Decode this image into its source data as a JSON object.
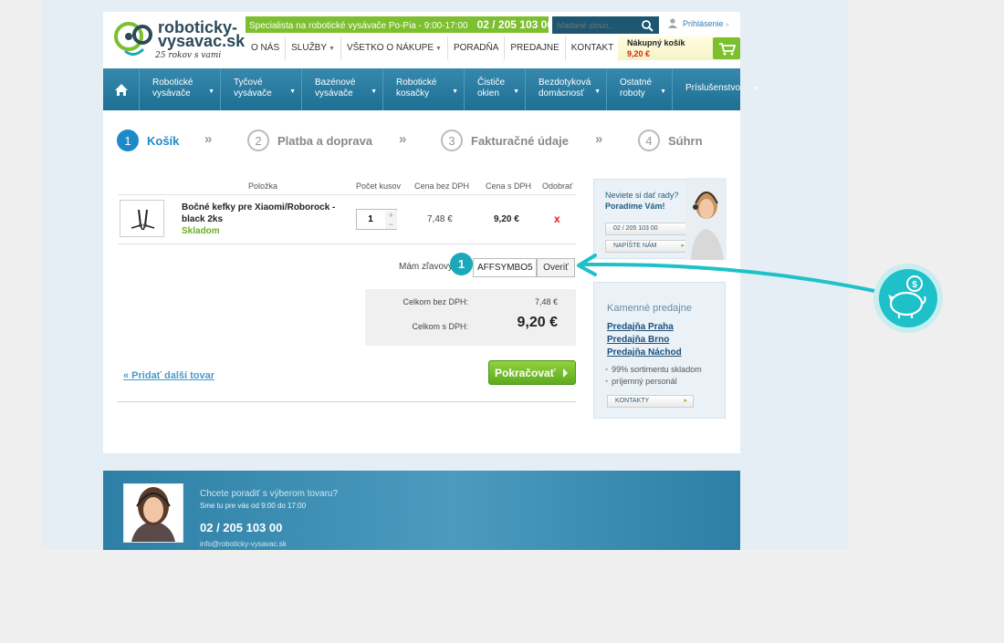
{
  "header": {
    "logo_line1": "roboticky-",
    "logo_line2": "vysavac.sk",
    "logo_slogan": "25 rokov s vami",
    "topbar_text": "Specialista na robotické vysávače   Po-Pia  -  9:00-17:00",
    "topbar_phone": "02 / 205 103 00",
    "search_placeholder": "hľadané slovo...",
    "login_label": "Prihlásenie",
    "nav": [
      {
        "label": "O NÁS",
        "dropdown": false
      },
      {
        "label": "SLUŽBY",
        "dropdown": true
      },
      {
        "label": "VŠETKO O NÁKUPE",
        "dropdown": true
      },
      {
        "label": "PORADŇA",
        "dropdown": false
      },
      {
        "label": "PREDAJNE",
        "dropdown": false
      },
      {
        "label": "KONTAKT",
        "dropdown": false
      }
    ],
    "cart_title": "Nákupný košík",
    "cart_total": "9,20 €"
  },
  "categories": [
    {
      "label": "Robotické vysávače"
    },
    {
      "label": "Tyčové vysávače"
    },
    {
      "label": "Bazénové vysávače"
    },
    {
      "label": "Robotické kosačky"
    },
    {
      "label": "Čističe okien"
    },
    {
      "label": "Bezdotyková domácnosť"
    },
    {
      "label": "Ostatné roboty"
    },
    {
      "label": "Príslušenstvo"
    }
  ],
  "steps": [
    {
      "num": "1",
      "label": "Košík"
    },
    {
      "num": "2",
      "label": "Platba a doprava"
    },
    {
      "num": "3",
      "label": "Fakturačné údaje"
    },
    {
      "num": "4",
      "label": "Súhrn"
    }
  ],
  "step_arrow": "»",
  "table": {
    "headers": [
      "Položka",
      "Počet kusov",
      "Cena bez DPH",
      "Cena s DPH",
      "Odobrať"
    ],
    "row": {
      "name": "Bočné kefky pre Xiaomi/Roborock - black 2ks",
      "stock": "Skladom",
      "qty": "1",
      "price_ex": "7,48 €",
      "price_inc": "9,20 €",
      "remove": "x"
    }
  },
  "coupon": {
    "label": "Mám zľavový kód:",
    "badge": "1",
    "value": "AFFSYMBO5",
    "verify": "Overiť"
  },
  "totals": {
    "label_ex": "Celkom bez DPH:",
    "value_ex": "7,48 €",
    "label_inc": "Celkom s DPH:",
    "value_inc": "9,20 €"
  },
  "actions": {
    "add_more": "« Pridať další tovar",
    "continue": "Pokračovať"
  },
  "sidebar": {
    "advice_q": "Neviete si dať rady?",
    "advice_a": "Poradíme Vám!",
    "advice_phone": "02 / 205 103 00",
    "advice_write": "NAPÍŠTE NÁM",
    "stores_title": "Kamenné predajne",
    "stores": [
      "Predajňa Praha",
      "Predajňa Brno",
      "Predajňa Náchod"
    ],
    "features": [
      "99% sortimentu skladom",
      "príjemný personál"
    ],
    "contacts": "KONTAKTY"
  },
  "footer": {
    "question": "Chcete poradiť s výberom tovaru?",
    "hours": "Sme tu pre vás od 9:00 do 17:00",
    "phone": "02 / 205 103 00",
    "email": "info@roboticky-vysavac.sk"
  },
  "colors": {
    "accent_blue": "#1d8ac8",
    "nav_blue": "#2a7ea5",
    "green": "#7cbf2f",
    "teal": "#1aa9b8",
    "remove_red": "#dd2222"
  },
  "icons": [
    "home-icon",
    "search-icon",
    "user-icon",
    "cart-icon",
    "piggy-bank-icon",
    "side-brush-icon"
  ]
}
